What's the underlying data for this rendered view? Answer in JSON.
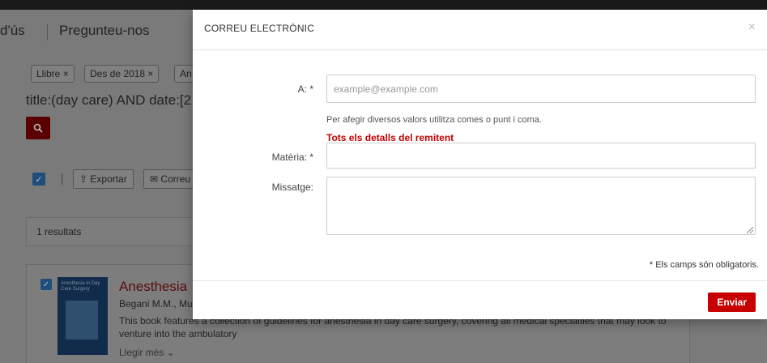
{
  "background": {
    "nav": {
      "item1": "d'ús",
      "item2": "Pregunteu-nos"
    },
    "chips": [
      {
        "label": "Llibre",
        "close": "×"
      },
      {
        "label": "Des de 2018",
        "close": "×"
      },
      {
        "label": "An"
      }
    ],
    "query_text": "title:(day care) AND date:[2",
    "toolbar": {
      "check": "✓",
      "export_label": "Exportar",
      "email_label": "Correu"
    },
    "results_count": "1 resultats",
    "result": {
      "check": "✓",
      "title": "Anesthesia",
      "authors": "Begani M.M., Mu",
      "description": "This book features a collection of guidelines for anesthesia in day care surgery, covering all medical specialties that may look to venture into the ambulatory",
      "read_more": "Llegir més",
      "cover_title": "Anesthesia in Day Care Surgery"
    }
  },
  "modal": {
    "title": "CORREU ELECTRÒNIC",
    "close": "×",
    "to_label": "A: *",
    "to_placeholder": "example@example.com",
    "to_value": "",
    "help_text": "Per afegir diversos valors utilitza comes o punt i coma.",
    "sender_link": "Tots els detalls del remitent",
    "subject_label": "Matèria: *",
    "subject_value": "",
    "message_label": "Missatge:",
    "message_value": "",
    "required_note": "* Els camps són obligatoris.",
    "send_label": "Enviar"
  },
  "colors": {
    "accent_red": "#c70000",
    "sender_red": "#c00000",
    "overlay": "#7a7a7a"
  },
  "icons": {
    "search": "search-icon",
    "export": "export-icon",
    "email": "envelope-icon",
    "close": "close-icon"
  }
}
